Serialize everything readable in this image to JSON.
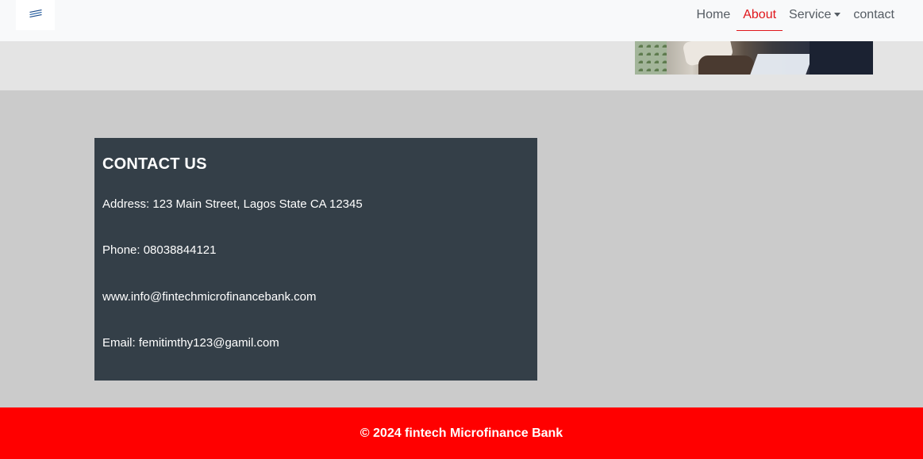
{
  "nav": {
    "brand_icon": "bank-logo-icon",
    "links": [
      {
        "label": "Home"
      },
      {
        "label": "About",
        "active": true
      },
      {
        "label": "Service",
        "dropdown": true
      },
      {
        "label": "contact"
      }
    ]
  },
  "contact": {
    "title": "CONTACT US",
    "address": "Address: 123 Main Street, Lagos State CA 12345",
    "phone": "Phone: 08038844121",
    "website": "www.info@fintechmicrofinancebank.com",
    "email": "Email: femitimthy123@gamil.com"
  },
  "footer": {
    "text": "© 2024 fintech Microfinance Bank"
  },
  "colors": {
    "accent": "#e0161b",
    "footer_bg": "#ff0000",
    "card_bg": "#343f48",
    "page_bg": "#cbcbcb"
  }
}
